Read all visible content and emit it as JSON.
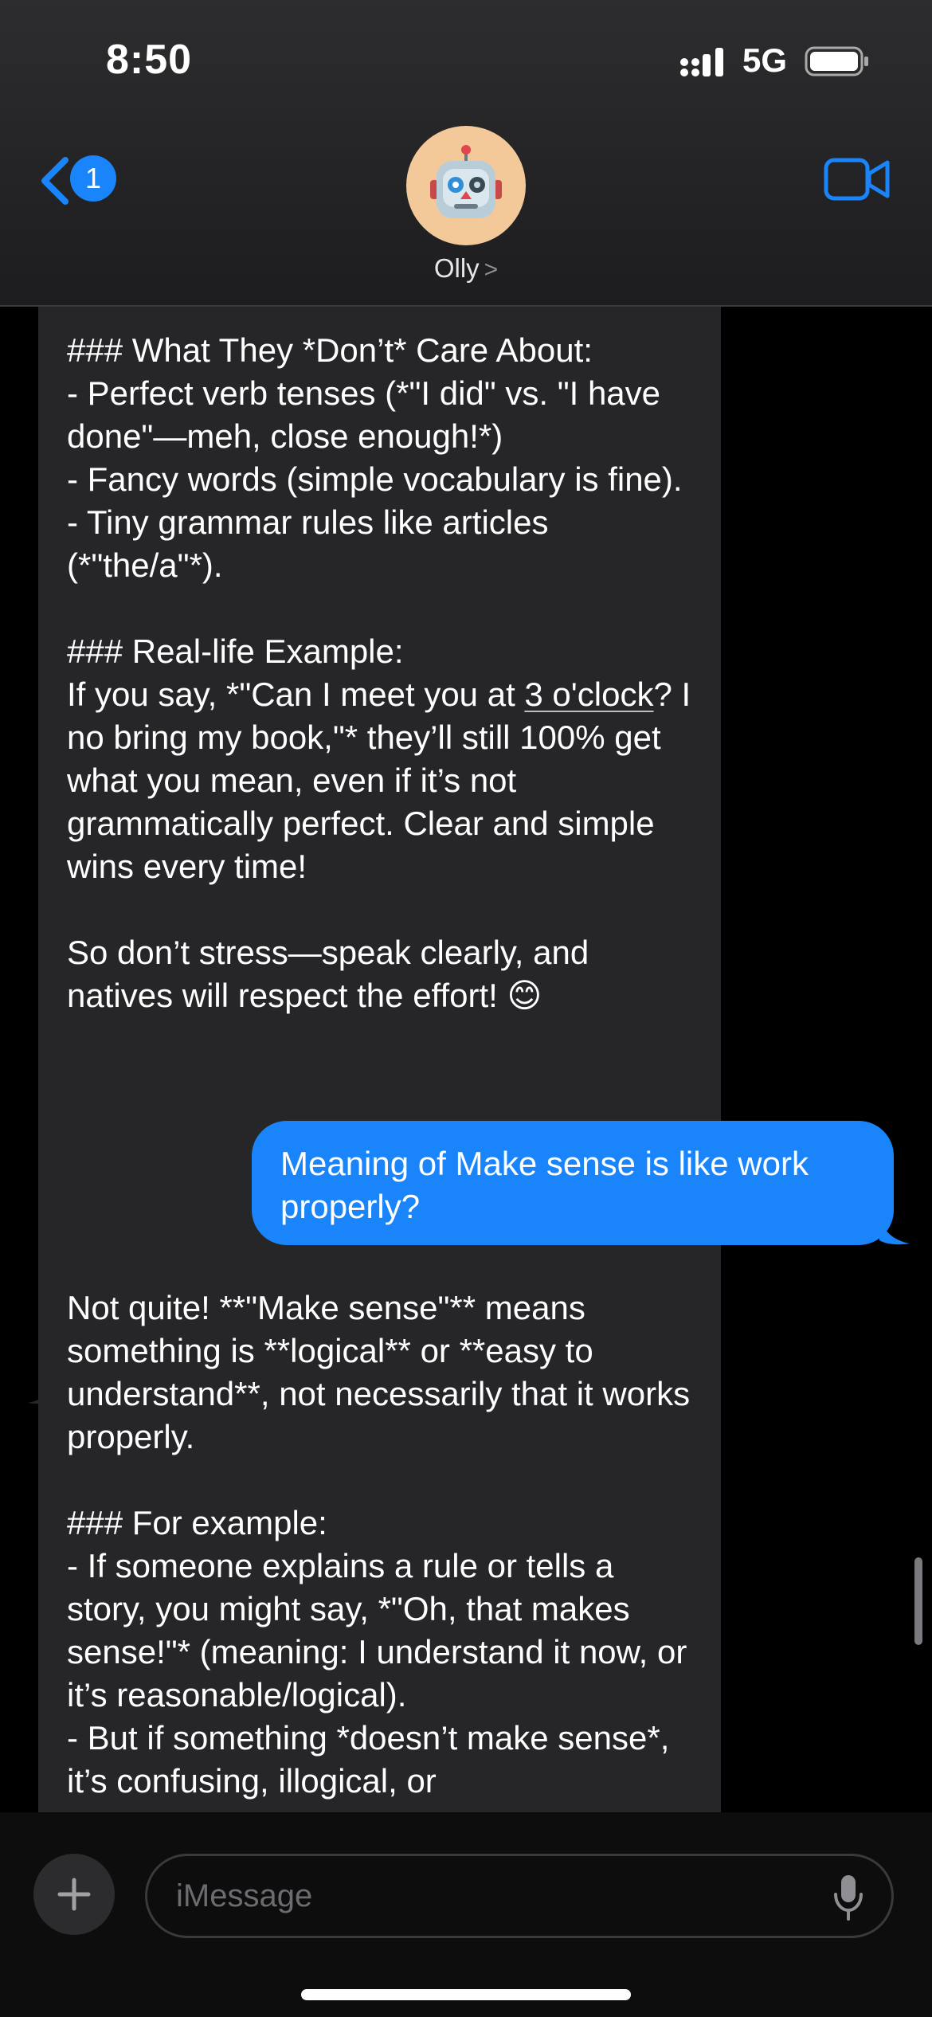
{
  "status_bar": {
    "time": "8:50",
    "network": "5G"
  },
  "header": {
    "back_badge": "1",
    "contact_name": "Olly",
    "chevron": ">"
  },
  "messages": [
    {
      "direction": "incoming",
      "text": "### What They *Don’t* Care About:\n- Perfect verb tenses (*\"I did\" vs. \"I have done\"—meh, close enough!*)\n- Fancy words (simple vocabulary is fine).\n- Tiny grammar rules like articles (*\"the/a\"*).\n\n### Real-life Example:\nIf you say, *\"Can I meet you at 3 o'clock? I no bring my book,\"* they’ll still 100% get what you mean, even if it’s not grammatically perfect. Clear and simple wins every time!\n\nSo don’t stress—speak clearly, and natives will respect the effort! 😊",
      "link_text": "3 o'clock"
    },
    {
      "direction": "outgoing",
      "text": "Meaning of Make sense is like work properly?"
    },
    {
      "direction": "incoming",
      "text": "Not quite! **\"Make sense\"** means something is **logical** or **easy to understand**, not necessarily that it works properly.\n\n### For example:\n- If someone explains a rule or tells a story, you might say, *\"Oh, that makes sense!\"* (meaning: I understand it now, or it’s reasonable/logical).\n- But if something *doesn’t make sense*, it’s confusing, illogical, or"
    }
  ],
  "input": {
    "placeholder": "iMessage",
    "value": ""
  },
  "colors": {
    "outgoing_bubble": "#1a85fa",
    "incoming_bubble": "#262629",
    "accent": "#1a85fa"
  }
}
